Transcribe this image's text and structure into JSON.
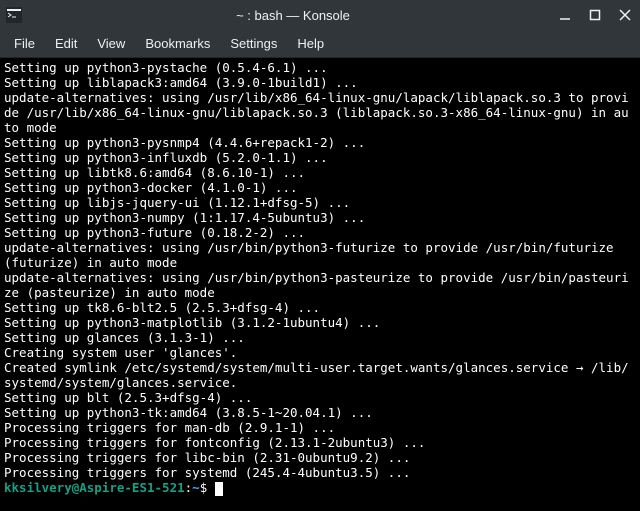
{
  "window": {
    "title": "~ : bash — Konsole"
  },
  "menu": {
    "file": "File",
    "edit": "Edit",
    "view": "View",
    "bookmarks": "Bookmarks",
    "settings": "Settings",
    "help": "Help"
  },
  "terminal": {
    "lines": [
      "Setting up python3-pystache (0.5.4-6.1) ...",
      "Setting up liblapack3:amd64 (3.9.0-1build1) ...",
      "update-alternatives: using /usr/lib/x86_64-linux-gnu/lapack/liblapack.so.3 to provide /usr/lib/x86_64-linux-gnu/liblapack.so.3 (liblapack.so.3-x86_64-linux-gnu) in auto mode",
      "Setting up python3-pysnmp4 (4.4.6+repack1-2) ...",
      "Setting up python3-influxdb (5.2.0-1.1) ...",
      "Setting up libtk8.6:amd64 (8.6.10-1) ...",
      "Setting up python3-docker (4.1.0-1) ...",
      "Setting up libjs-jquery-ui (1.12.1+dfsg-5) ...",
      "Setting up python3-numpy (1:1.17.4-5ubuntu3) ...",
      "Setting up python3-future (0.18.2-2) ...",
      "update-alternatives: using /usr/bin/python3-futurize to provide /usr/bin/futurize (futurize) in auto mode",
      "update-alternatives: using /usr/bin/python3-pasteurize to provide /usr/bin/pasteurize (pasteurize) in auto mode",
      "Setting up tk8.6-blt2.5 (2.5.3+dfsg-4) ...",
      "Setting up python3-matplotlib (3.1.2-1ubuntu4) ...",
      "Setting up glances (3.1.3-1) ...",
      "Creating system user 'glances'.",
      "Created symlink /etc/systemd/system/multi-user.target.wants/glances.service → /lib/systemd/system/glances.service.",
      "Setting up blt (2.5.3+dfsg-4) ...",
      "Setting up python3-tk:amd64 (3.8.5-1~20.04.1) ...",
      "Processing triggers for man-db (2.9.1-1) ...",
      "Processing triggers for fontconfig (2.13.1-2ubuntu3) ...",
      "Processing triggers for libc-bin (2.31-0ubuntu9.2) ...",
      "Processing triggers for systemd (245.4-4ubuntu3.5) ..."
    ],
    "prompt_user": "kksilvery@Aspire-ES1-521",
    "prompt_colon": ":",
    "prompt_path": "~",
    "prompt_symbol": "$ "
  }
}
